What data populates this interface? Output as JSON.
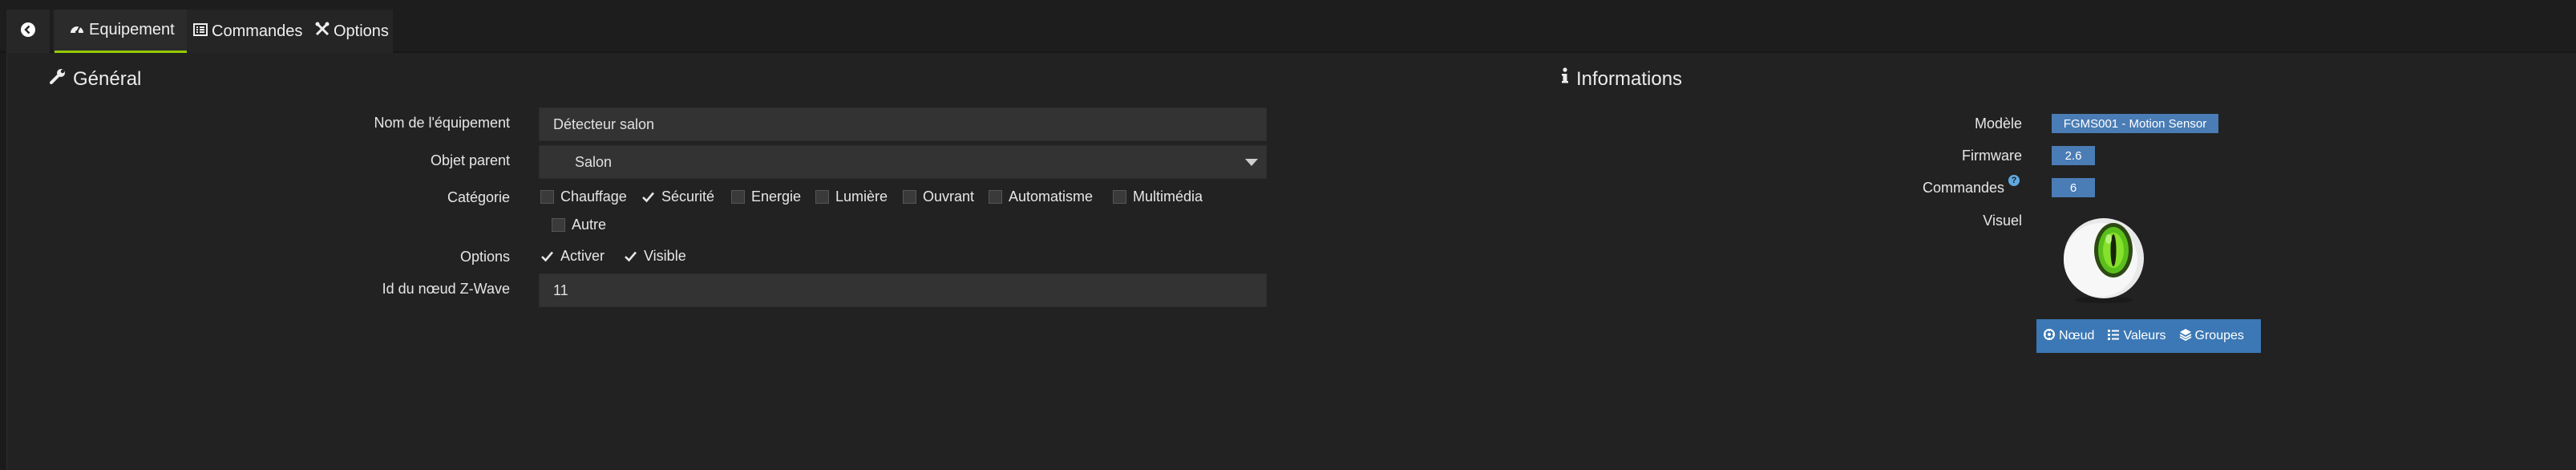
{
  "tabs": [
    {
      "label": "Equipement",
      "icon": "gauge-icon",
      "active": true
    },
    {
      "label": "Commandes",
      "icon": "list-alt-icon",
      "active": false
    },
    {
      "label": "Options",
      "icon": "tools-icon",
      "active": false
    }
  ],
  "general": {
    "title": "Général",
    "fields": {
      "name_label": "Nom de l'équipement",
      "name_value": "Détecteur salon",
      "parent_label": "Objet parent",
      "parent_value": "Salon",
      "category_label": "Catégorie",
      "categories": [
        {
          "label": "Chauffage",
          "checked": false
        },
        {
          "label": "Sécurité",
          "checked": true
        },
        {
          "label": "Energie",
          "checked": false
        },
        {
          "label": "Lumière",
          "checked": false
        },
        {
          "label": "Ouvrant",
          "checked": false
        },
        {
          "label": "Automatisme",
          "checked": false
        },
        {
          "label": "Multimédia",
          "checked": false
        },
        {
          "label": "Autre",
          "checked": false
        }
      ],
      "options_label": "Options",
      "options": [
        {
          "label": "Activer",
          "checked": true
        },
        {
          "label": "Visible",
          "checked": true
        }
      ],
      "node_label": "Id du nœud Z-Wave",
      "node_value": "11"
    }
  },
  "informations": {
    "title": "Informations",
    "modele_label": "Modèle",
    "modele_value": "FGMS001 - Motion Sensor",
    "firmware_label": "Firmware",
    "firmware_value": "2.6",
    "commandes_label": "Commandes",
    "commandes_help": "?",
    "commandes_value": "6",
    "visuel_label": "Visuel",
    "buttons": [
      {
        "label": "Nœud",
        "icon": "nodes-icon"
      },
      {
        "label": "Valeurs",
        "icon": "list-icon"
      },
      {
        "label": "Groupes",
        "icon": "layers-icon"
      }
    ]
  },
  "colors": {
    "accent": "#93ca02",
    "badge": "#4a7cb5",
    "button_bar": "#3b78b5"
  }
}
